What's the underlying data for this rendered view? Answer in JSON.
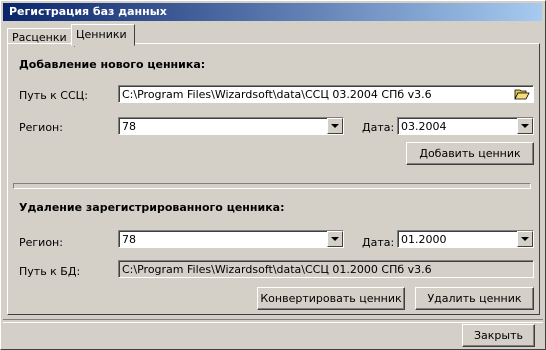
{
  "window": {
    "title": "Регистрация баз данных"
  },
  "tabs": [
    {
      "label": "Расценки"
    },
    {
      "label": "Ценники"
    }
  ],
  "add_section": {
    "heading": "Добавление нового ценника:",
    "path_label": "Путь к ССЦ:",
    "path_value": "C:\\Program Files\\Wizardsoft\\data\\ССЦ 03.2004 СПб v3.6",
    "region_label": "Регион:",
    "region_value": "78",
    "date_label": "Дата:",
    "date_value": "03.2004",
    "add_button": "Добавить ценник"
  },
  "remove_section": {
    "heading": "Удаление зарегистрированного ценника:",
    "region_label": "Регион:",
    "region_value": "78",
    "date_label": "Дата:",
    "date_value": "01.2000",
    "db_path_label": "Путь к БД:",
    "db_path_value": "C:\\Program Files\\Wizardsoft\\data\\ССЦ 01.2000 СПб v3.6",
    "convert_button": "Конвертировать ценник",
    "delete_button": "Удалить ценник"
  },
  "footer": {
    "close_button": "Закрыть"
  }
}
